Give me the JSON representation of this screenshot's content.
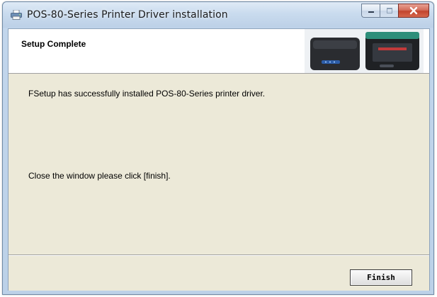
{
  "window": {
    "title": "POS-80-Series Printer Driver installation",
    "icon": "printer-icon",
    "caption_buttons": [
      "minimize-icon",
      "maximize-icon",
      "close-icon"
    ]
  },
  "header": {
    "title": "Setup Complete",
    "image": "printer-photo"
  },
  "body": {
    "message_success": "FSetup has successfully installed POS-80-Series printer driver.",
    "message_close": "Close the window please click [finish]."
  },
  "footer": {
    "finish_label": "Finish"
  },
  "colors": {
    "dialog_background": "#ece9d8",
    "header_background": "#ffffff",
    "close_button": "#c2442e"
  }
}
